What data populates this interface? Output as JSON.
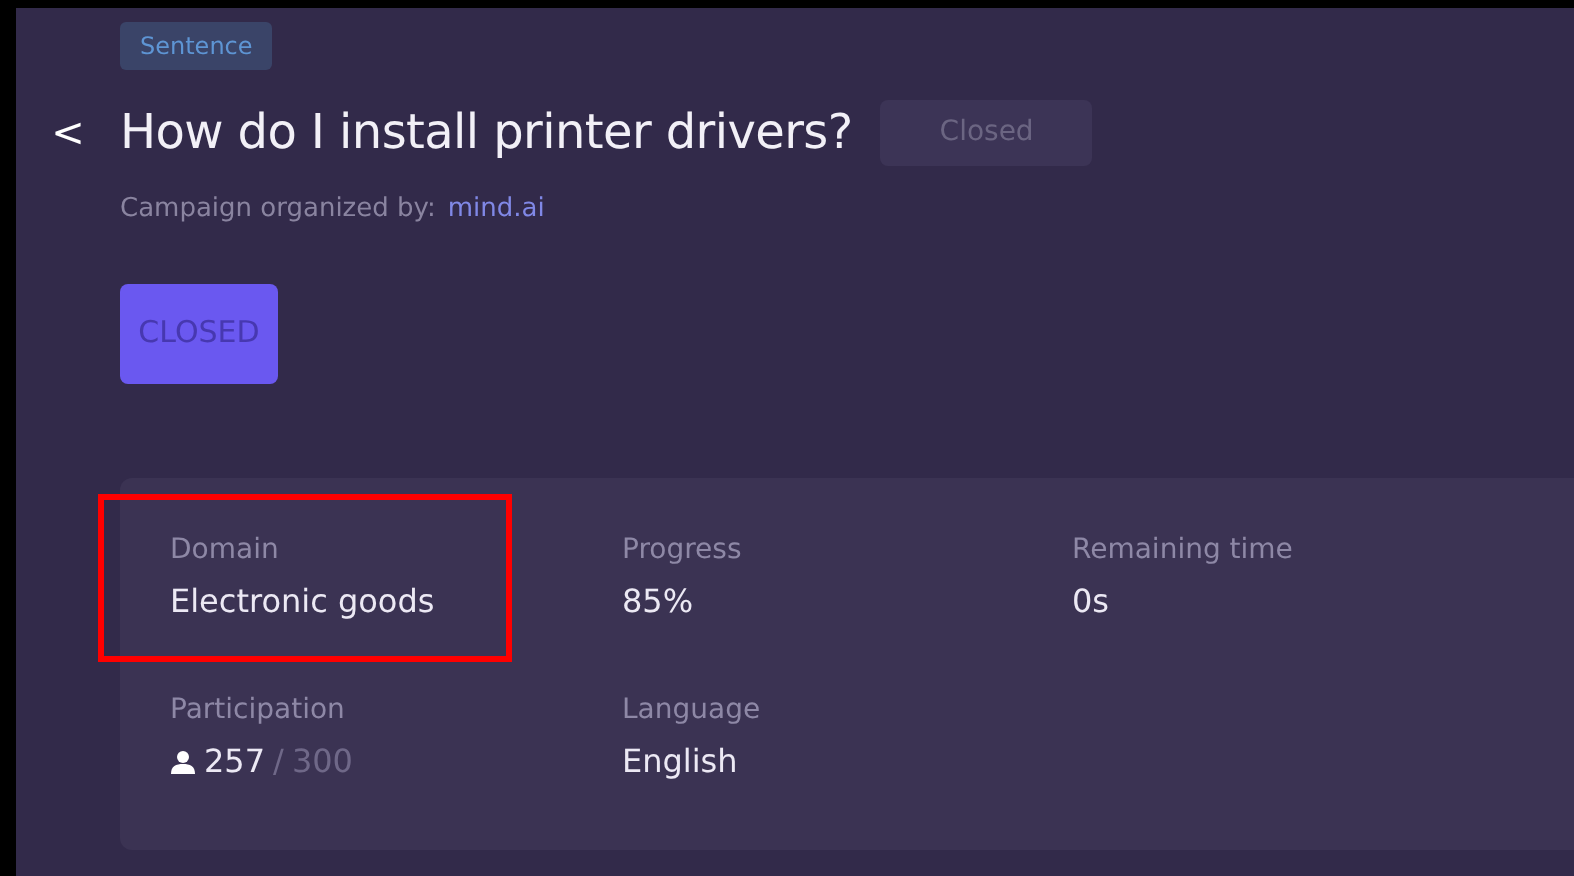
{
  "tag": "Sentence",
  "back": "<",
  "title": "How do I install printer drivers?",
  "status_badge": "Closed",
  "organizer": {
    "label": "Campaign organized by:",
    "name": "mind.ai"
  },
  "action_button": {
    "label": "CLOSED",
    "disabled": true
  },
  "stats": [
    {
      "kind": "text",
      "label": "Domain",
      "value": "Electronic goods",
      "highlighted": true
    },
    {
      "kind": "text",
      "label": "Progress",
      "value": "85%",
      "highlighted": false
    },
    {
      "kind": "text",
      "label": "Remaining time",
      "value": "0s",
      "highlighted": false
    },
    {
      "kind": "participation",
      "label": "Participation",
      "current": "257",
      "separator": "/",
      "total": "300",
      "highlighted": false
    },
    {
      "kind": "text",
      "label": "Language",
      "value": "English",
      "highlighted": false
    }
  ]
}
